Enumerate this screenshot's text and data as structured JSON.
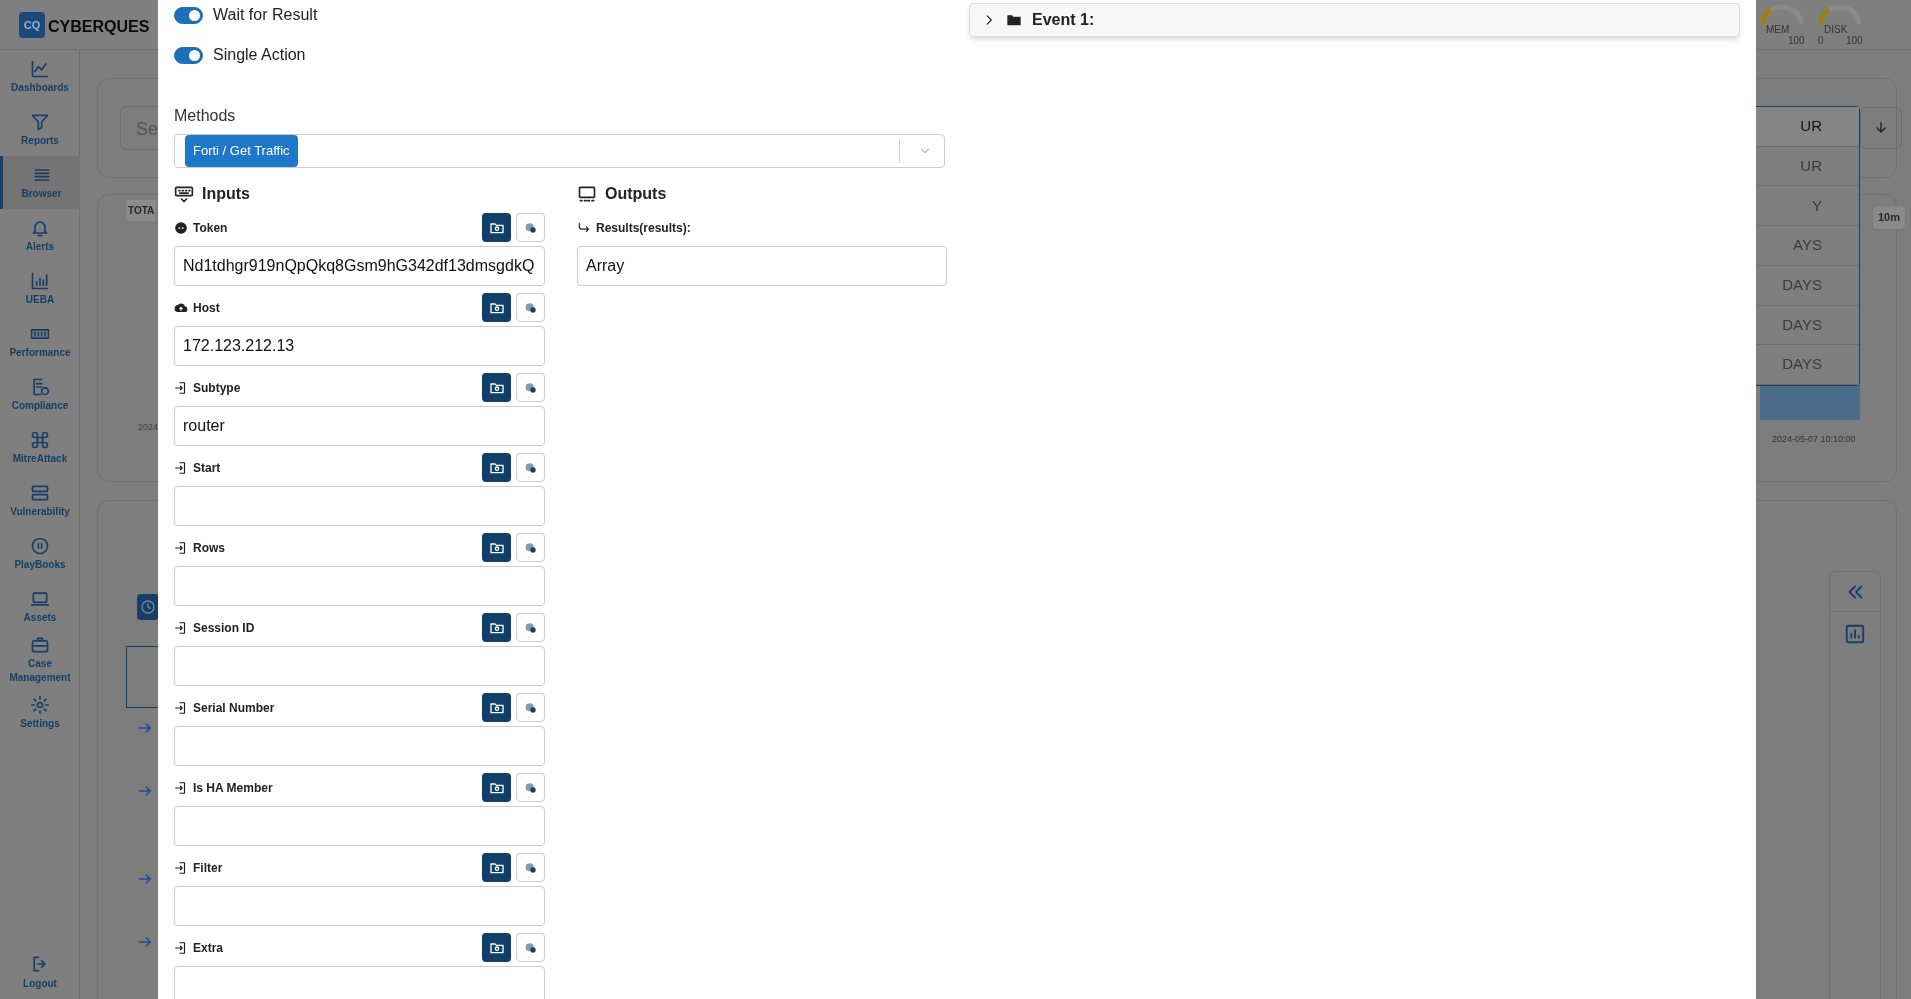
{
  "app": {
    "brand_mark": "CQ",
    "brand_name": "CYBERQUES"
  },
  "sidebar": {
    "items": [
      {
        "label": "Dashboards",
        "selected": false
      },
      {
        "label": "Reports",
        "selected": false
      },
      {
        "label": "Browser",
        "selected": true
      },
      {
        "label": "Alerts",
        "selected": false
      },
      {
        "label": "UEBA",
        "selected": false
      },
      {
        "label": "Performance",
        "selected": false
      },
      {
        "label": "Compliance",
        "selected": false
      },
      {
        "label": "MitreAttack",
        "selected": false
      },
      {
        "label": "Vulnerability",
        "selected": false
      },
      {
        "label": "PlayBooks",
        "selected": false
      },
      {
        "label": "Assets",
        "selected": false
      },
      {
        "label": "Case Management",
        "selected": false
      },
      {
        "label": "Settings",
        "selected": false
      }
    ],
    "logout": "Logout"
  },
  "background": {
    "search_fragment": "Se",
    "total_fragment": "TOTA",
    "date_fragment": "2024",
    "gauges": [
      {
        "label": "MEM",
        "max": "100"
      },
      {
        "label": "DISK",
        "min": "0",
        "max": "100"
      }
    ],
    "range_options": [
      {
        "label": "UR",
        "selected": true
      },
      {
        "label": "UR",
        "selected": false
      },
      {
        "label": "Y",
        "selected": false
      },
      {
        "label": "AYS",
        "selected": false
      },
      {
        "label": "DAYS",
        "selected": false
      },
      {
        "label": "DAYS",
        "selected": false
      },
      {
        "label": "DAYS",
        "selected": false
      }
    ],
    "interval": "10m",
    "axis_time": "2024-05-07 10:10:00"
  },
  "modal": {
    "toggles": [
      {
        "label": "Wait for Result",
        "on": true
      },
      {
        "label": "Single Action",
        "on": true
      }
    ],
    "methods": {
      "label": "Methods",
      "chips": [
        "Forti / Get Traffic"
      ]
    },
    "inputs": {
      "title": "Inputs",
      "fields": [
        {
          "label": "Token",
          "kind": "secret",
          "value": "Nd1tdhgr919nQpQkq8Gsm9hG342df13dmsgdkQ"
        },
        {
          "label": "Host",
          "kind": "cloud",
          "value": "172.123.212.13"
        },
        {
          "label": "Subtype",
          "kind": "input",
          "value": "router"
        },
        {
          "label": "Start",
          "kind": "input"
        },
        {
          "label": "Rows",
          "kind": "input"
        },
        {
          "label": "Session ID",
          "kind": "input"
        },
        {
          "label": "Serial Number",
          "kind": "input"
        },
        {
          "label": "Is HA Member",
          "kind": "input"
        },
        {
          "label": "Filter",
          "kind": "input"
        },
        {
          "label": "Extra",
          "kind": "input"
        }
      ]
    },
    "outputs": {
      "title": "Outputs",
      "fields": [
        {
          "label": "Results(results):",
          "value": "Array"
        }
      ]
    },
    "events": [
      {
        "title": "Event 1:",
        "expanded": false
      }
    ]
  }
}
